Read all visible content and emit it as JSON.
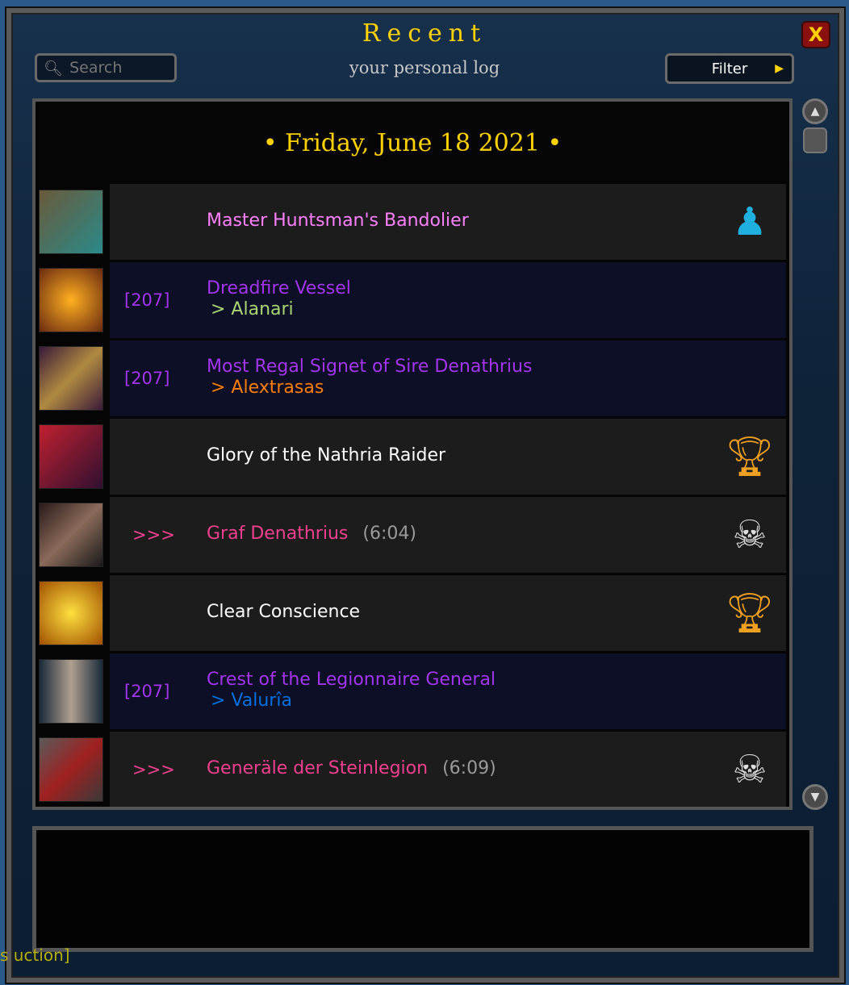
{
  "header": {
    "title": "Recent",
    "subtitle": "your personal log",
    "search_placeholder": "Search",
    "filter_label": "Filter",
    "close_label": "X"
  },
  "log": {
    "date": "• Friday, June 18 2021 •",
    "entries": [
      {
        "name": "Master Huntsman's Bandolier",
        "level": "",
        "recipient": "",
        "time": "",
        "name_color": "#ff80ff",
        "recipient_color": "",
        "bg": "n",
        "icon": "mannequin-icon",
        "thumb": "linear-gradient(135deg,#6a5a3a,#2a8a8a)"
      },
      {
        "name": "Dreadfire Vessel",
        "level": "[207]",
        "recipient": "> Alanari",
        "time": "",
        "name_color": "#a335ee",
        "recipient_color": "#abd473",
        "bg": "l",
        "icon": "",
        "thumb": "radial-gradient(#ffb020,#6a2a10)"
      },
      {
        "name": "Most Regal Signet of Sire Denathrius",
        "level": "[207]",
        "recipient": "> Alextrasas",
        "time": "",
        "name_color": "#a335ee",
        "recipient_color": "#ff7d0a",
        "bg": "l",
        "icon": "",
        "thumb": "linear-gradient(135deg,#3a1a3a,#b08a40,#3a1a3a)"
      },
      {
        "name": "Glory of the Nathria Raider",
        "level": "",
        "recipient": "",
        "time": "",
        "name_color": "#ffffff",
        "recipient_color": "",
        "bg": "n",
        "icon": "trophy-icon",
        "thumb": "linear-gradient(135deg,#c02030,#301030)"
      },
      {
        "name": "Graf Denathrius",
        "level": ">>>",
        "recipient": "",
        "time": "(6:04)",
        "name_color": "#f0408f",
        "recipient_color": "",
        "bg": "n",
        "icon": "skull-crossbones-icon",
        "thumb": "linear-gradient(135deg,#2a1a1a,#8a6a5a,#1a1a1a)"
      },
      {
        "name": "Clear Conscience",
        "level": "",
        "recipient": "",
        "time": "",
        "name_color": "#ffffff",
        "recipient_color": "",
        "bg": "n",
        "icon": "trophy-icon",
        "thumb": "radial-gradient(#ffe040,#a05000)"
      },
      {
        "name": "Crest of the Legionnaire General",
        "level": "[207]",
        "recipient": "> Valurîa",
        "time": "",
        "name_color": "#a335ee",
        "recipient_color": "#0070de",
        "bg": "l",
        "icon": "",
        "thumb": "linear-gradient(90deg,#1a2a3a,#b0a090,#1a2a3a)"
      },
      {
        "name": "Generäle der Steinlegion",
        "level": ">>>",
        "recipient": "",
        "time": "(6:09)",
        "name_color": "#f0408f",
        "recipient_color": "",
        "bg": "n",
        "icon": "skull-crossbones-icon",
        "thumb": "linear-gradient(135deg,#5a5a5a,#a02020,#3a3a3a)"
      }
    ]
  },
  "footer": {
    "fragment": "s uction]"
  }
}
